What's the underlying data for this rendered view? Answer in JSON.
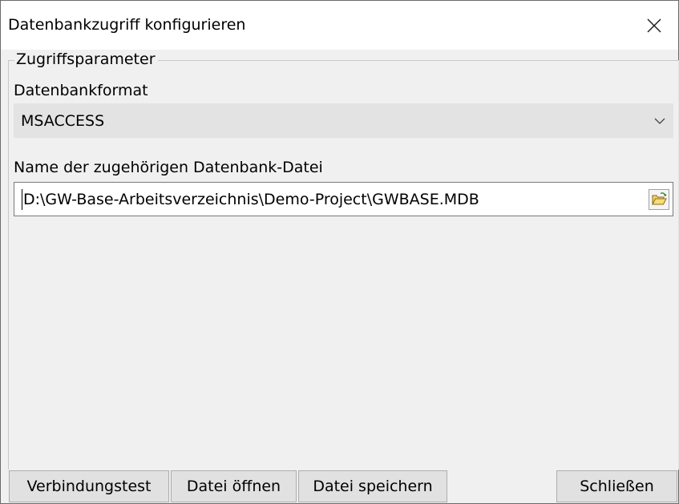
{
  "window": {
    "title": "Datenbankzugriff konfigurieren"
  },
  "group": {
    "legend": "Zugriffsparameter"
  },
  "format": {
    "label": "Datenbankformat",
    "selected": "MSACCESS"
  },
  "file": {
    "label": "Name der zugehörigen Datenbank-Datei",
    "value": "D:\\GW-Base-Arbeitsverzeichnis\\Demo-Project\\GWBASE.MDB"
  },
  "buttons": {
    "test": "Verbindungstest",
    "open": "Datei öffnen",
    "save": "Datei speichern",
    "close": "Schließen"
  },
  "icons": {
    "close": "close-icon",
    "dropdown": "chevron-down-icon",
    "browse": "folder-open-icon"
  },
  "colors": {
    "window_bg": "#f0f0f0",
    "titlebar_bg": "#ffffff",
    "combo_bg": "#e3e3e3",
    "button_bg": "#e1e1e1",
    "folder": "#f2d06b"
  }
}
